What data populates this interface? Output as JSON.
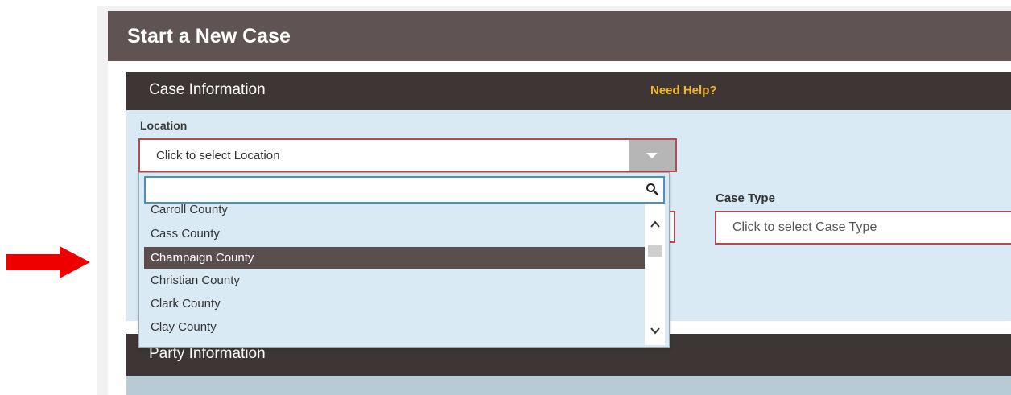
{
  "page": {
    "title": "Start a New Case"
  },
  "case_information": {
    "heading": "Case Information",
    "help_link": "Need Help?",
    "location": {
      "label": "Location",
      "placeholder": "Click to select Location"
    },
    "case_type": {
      "label": "Case Type",
      "placeholder": "Click to select Case Type"
    }
  },
  "location_dropdown": {
    "search_value": "",
    "items": [
      {
        "label": "Carroll County"
      },
      {
        "label": "Cass County"
      },
      {
        "label": "Champaign County"
      },
      {
        "label": "Christian County"
      },
      {
        "label": "Clark County"
      },
      {
        "label": "Clay County"
      }
    ],
    "highlighted": "Champaign County"
  },
  "party_information": {
    "heading": "Party Information"
  },
  "colors": {
    "header": "#5f5453",
    "section_bar": "#3e3634",
    "section_bg": "#daeaf5",
    "help_link": "#f0b62d",
    "field_border": "#b24a4f",
    "highlight_row": "#5a4f4d",
    "arrow": "#ee0000"
  },
  "icons": {
    "pointer_arrow": "right-arrow-icon",
    "dropdown_toggle": "caret-down-icon",
    "search": "search-icon",
    "scroll_up": "chevron-up-icon",
    "scroll_down": "chevron-down-icon"
  }
}
